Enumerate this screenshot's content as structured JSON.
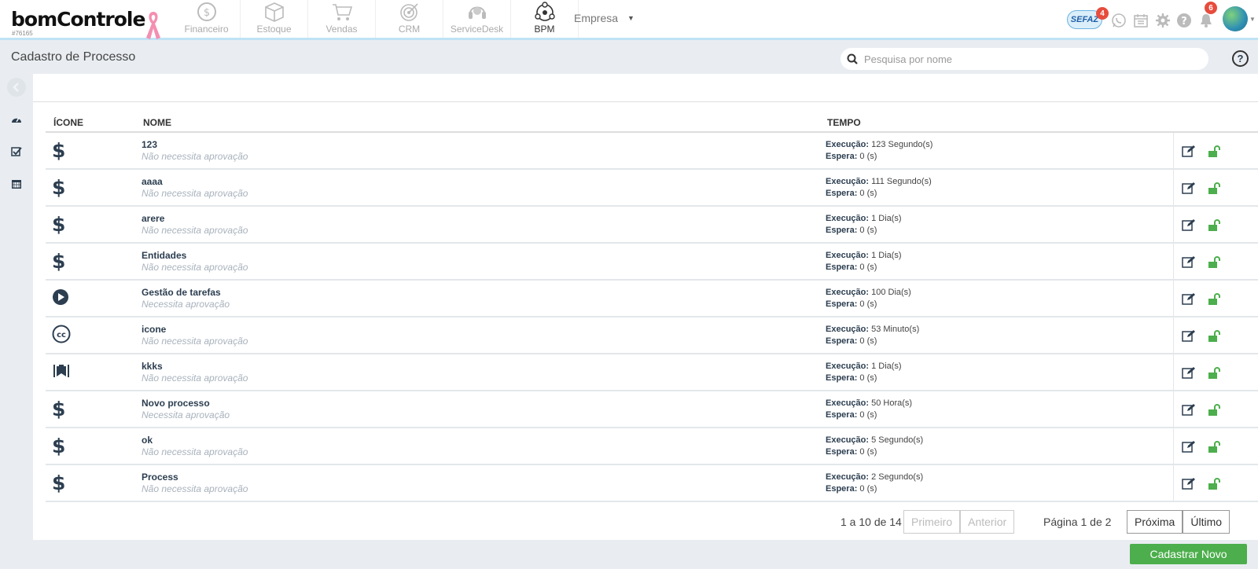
{
  "app": {
    "logo": "bomControle",
    "account_id": "#76165"
  },
  "nav": [
    {
      "label": "Financeiro",
      "icon": "dollar-circle-icon"
    },
    {
      "label": "Estoque",
      "icon": "box-icon"
    },
    {
      "label": "Vendas",
      "icon": "cart-icon"
    },
    {
      "label": "CRM",
      "icon": "target-icon"
    },
    {
      "label": "ServiceDesk",
      "icon": "headset-icon"
    },
    {
      "label": "BPM",
      "icon": "process-icon"
    }
  ],
  "empresa": "Empresa",
  "top_right": {
    "sefaz_label": "SEFAZ",
    "sefaz_badge": "4",
    "notifications_badge": "6"
  },
  "page": {
    "title": "Cadastro de Processo",
    "search_placeholder": "Pesquisa por nome"
  },
  "table": {
    "headers": [
      "ÍCONE",
      "NOME",
      "TEMPO"
    ],
    "execucao_label": "Execução:",
    "espera_label": "Espera:",
    "rows": [
      {
        "icon": "dollar-icon",
        "name": "123",
        "approval": "Não necessita aprovação",
        "execucao": "123 Segundo(s)",
        "espera": "0 (s)"
      },
      {
        "icon": "dollar-icon",
        "name": "aaaa",
        "approval": "Não necessita aprovação",
        "execucao": "111 Segundo(s)",
        "espera": "0 (s)"
      },
      {
        "icon": "dollar-icon",
        "name": "arere",
        "approval": "Não necessita aprovação",
        "execucao": "1 Dia(s)",
        "espera": "0 (s)"
      },
      {
        "icon": "dollar-icon",
        "name": "Entidades",
        "approval": "Não necessita aprovação",
        "execucao": "1 Dia(s)",
        "espera": "0 (s)"
      },
      {
        "icon": "play-circle-icon",
        "name": "Gestão de tarefas",
        "approval": "Necessita aprovação",
        "execucao": "100 Dia(s)",
        "espera": "0 (s)"
      },
      {
        "icon": "cc-icon",
        "name": "icone",
        "approval": "Não necessita aprovação",
        "execucao": "53 Minuto(s)",
        "espera": "0 (s)"
      },
      {
        "icon": "fort-icon",
        "name": "kkks",
        "approval": "Não necessita aprovação",
        "execucao": "1 Dia(s)",
        "espera": "0 (s)"
      },
      {
        "icon": "dollar-icon",
        "name": "Novo processo",
        "approval": "Necessita aprovação",
        "execucao": "50 Hora(s)",
        "espera": "0 (s)"
      },
      {
        "icon": "dollar-icon",
        "name": "ok",
        "approval": "Não necessita aprovação",
        "execucao": "5 Segundo(s)",
        "espera": "0 (s)"
      },
      {
        "icon": "dollar-icon",
        "name": "Process",
        "approval": "Não necessita aprovação",
        "execucao": "2 Segundo(s)",
        "espera": "0 (s)"
      }
    ]
  },
  "pagination": {
    "count": "1 a 10 de 14",
    "first": "Primeiro",
    "prev": "Anterior",
    "page": "Página 1 de 2",
    "next": "Próxima",
    "last": "Último"
  },
  "actions": {
    "new": "Cadastrar Novo"
  },
  "colors": {
    "accent_green": "#4cae4c",
    "badge_red": "#e74c3c",
    "topbar_border": "#bfe3f5"
  }
}
